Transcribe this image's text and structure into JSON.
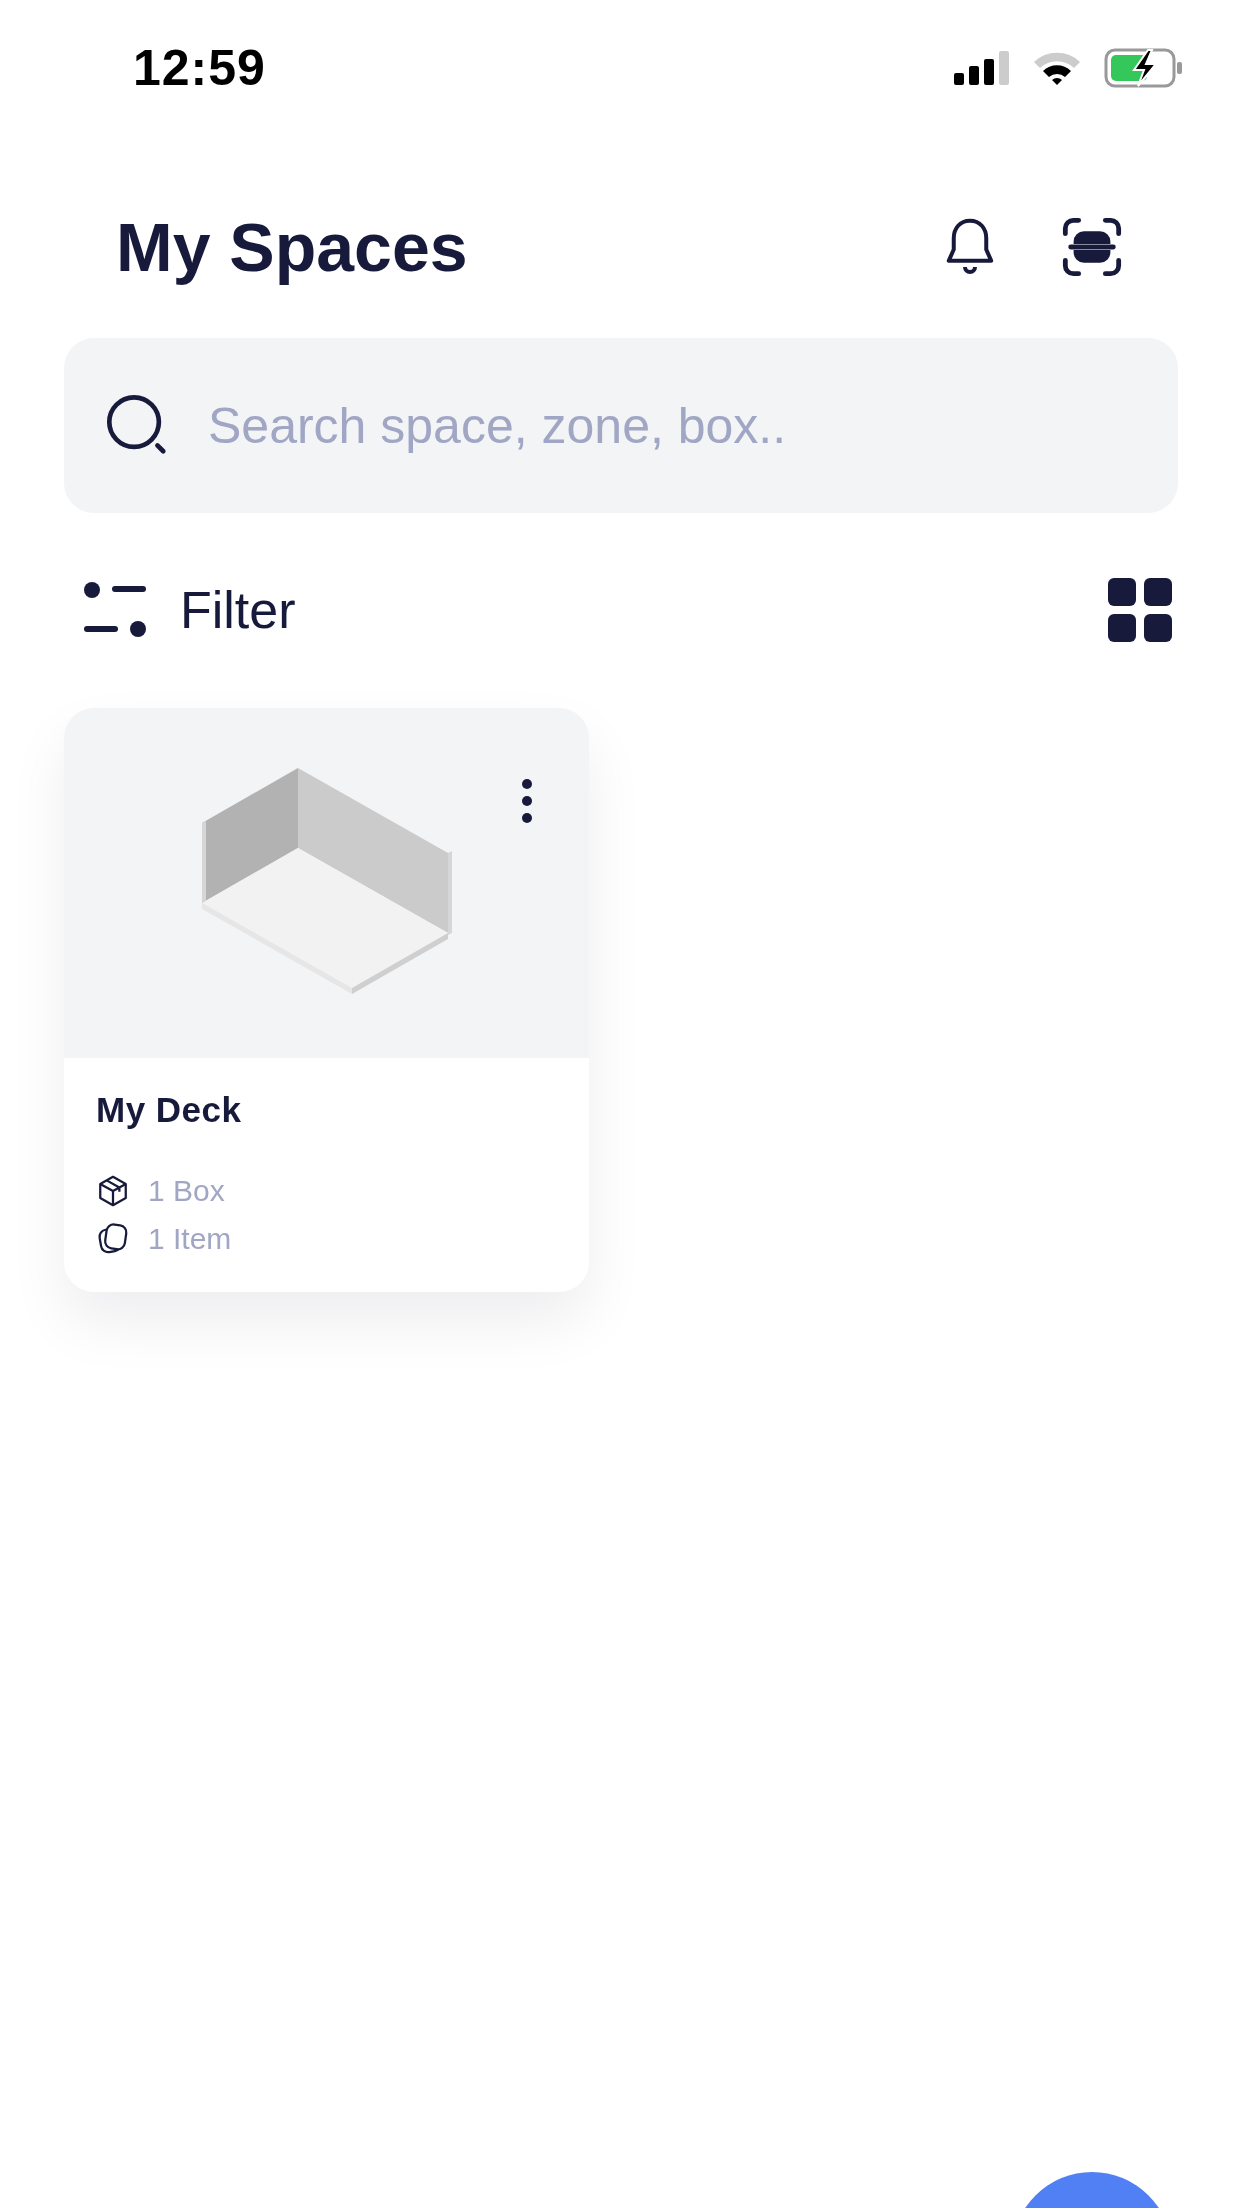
{
  "status_bar": {
    "time": "12:59"
  },
  "header": {
    "title": "My Spaces"
  },
  "search": {
    "placeholder": "Search space, zone, box.."
  },
  "filter": {
    "label": "Filter"
  },
  "spaces": [
    {
      "name": "My Deck",
      "stats": [
        {
          "kind": "box",
          "text": "1 Box"
        },
        {
          "kind": "item",
          "text": "1 Item"
        }
      ]
    }
  ]
}
